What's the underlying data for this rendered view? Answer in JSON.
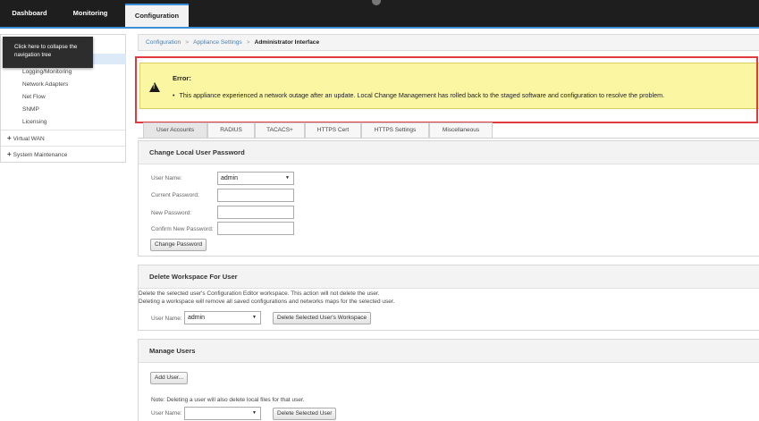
{
  "topnav": {
    "tabs": [
      {
        "label": "Dashboard"
      },
      {
        "label": "Monitoring"
      },
      {
        "label": "Configuration"
      }
    ]
  },
  "sidebar": {
    "tooltip": [
      "Click here to collapse the",
      "navigation tree"
    ],
    "items": [
      "Logging/Monitoring",
      "Network Adapters",
      "Net Flow",
      "SNMP",
      "Licensing"
    ],
    "groups": [
      "Virtual WAN",
      "System Maintenance"
    ],
    "group_prefix": "+"
  },
  "breadcrumb": {
    "items": [
      "Configuration",
      "Appliance Settings"
    ],
    "current": "Administrator Interface",
    "separator": ">"
  },
  "error": {
    "title": "Error:",
    "message": "This appliance experienced a network outage after an update. Local Change Management has rolled back to the staged software and configuration to resolve the problem."
  },
  "tabs": [
    "User Accounts",
    "RADIUS",
    "TACACS+",
    "HTTPS Cert",
    "HTTPS Settings",
    "Miscellaneous"
  ],
  "change_password": {
    "title": "Change Local User Password",
    "user_name_label": "User Name:",
    "user_name_value": "admin",
    "current_password_label": "Current Password:",
    "new_password_label": "New Password:",
    "confirm_password_label": "Confirm New Password:",
    "button": "Change Password"
  },
  "delete_workspace": {
    "title": "Delete Workspace For User",
    "line1": "Delete the selected user's Configuration Editor workspace. This action will not delete the user.",
    "line2": "Deleting a workspace will remove all saved configurations and networks maps for the selected user.",
    "user_name_label": "User Name:",
    "user_name_value": "admin",
    "button": "Delete Selected User's Workspace"
  },
  "manage_users": {
    "title": "Manage Users",
    "add_button": "Add User...",
    "note": "Note: Deleting a user will also delete local files for that user.",
    "user_name_label": "User Name:",
    "user_name_value": "",
    "delete_button": "Delete Selected User"
  }
}
